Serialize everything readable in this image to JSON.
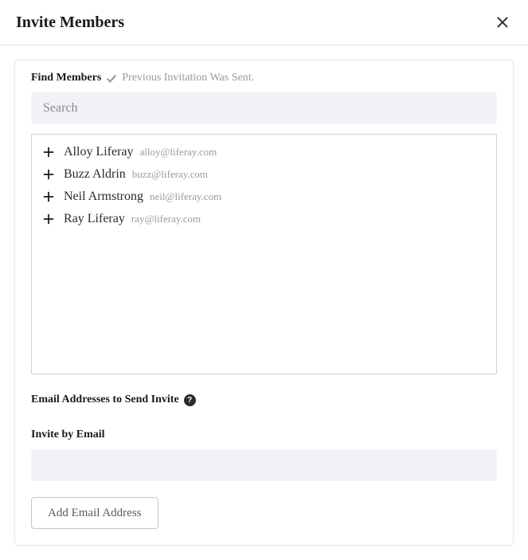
{
  "header": {
    "title": "Invite Members"
  },
  "find_members": {
    "label": "Find Members",
    "status": "Previous Invitation Was Sent.",
    "search_placeholder": "Search",
    "search_value": ""
  },
  "members": [
    {
      "name": "Alloy Liferay",
      "email": "alloy@liferay.com"
    },
    {
      "name": "Buzz Aldrin",
      "email": "buzz@liferay.com"
    },
    {
      "name": "Neil Armstrong",
      "email": "neil@liferay.com"
    },
    {
      "name": "Ray Liferay",
      "email": "ray@liferay.com"
    }
  ],
  "email_section": {
    "heading": "Email Addresses to Send Invite",
    "help_char": "?",
    "sub_label": "Invite by Email",
    "input_value": "",
    "button_label": "Add Email Address"
  }
}
